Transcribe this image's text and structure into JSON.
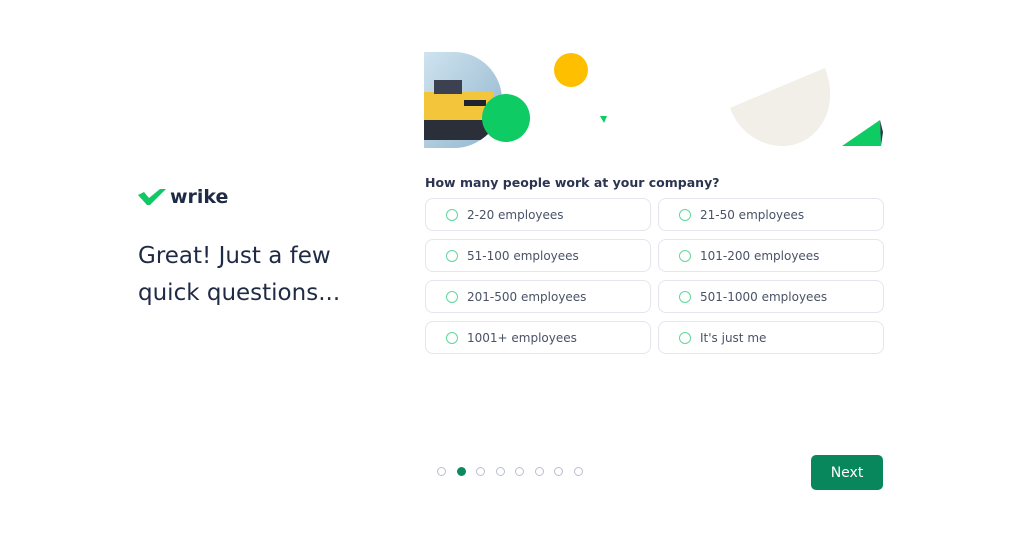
{
  "brand": {
    "name": "wrike",
    "logo_icon": "wrike-check-icon",
    "accent": "#0ecb6a"
  },
  "headline": "Great! Just a few quick questions...",
  "hero": {
    "image": "race-car-image",
    "decor": [
      "yellow-circle",
      "green-circle",
      "green-triangle",
      "beige-semicircle"
    ]
  },
  "question": "How many people work at your company?",
  "options": [
    {
      "label": "2-20 employees",
      "selected": false
    },
    {
      "label": "21-50 employees",
      "selected": false
    },
    {
      "label": "51-100 employees",
      "selected": false
    },
    {
      "label": "101-200 employees",
      "selected": false
    },
    {
      "label": "201-500 employees",
      "selected": false
    },
    {
      "label": "501-1000 employees",
      "selected": false
    },
    {
      "label": "1001+ employees",
      "selected": false
    },
    {
      "label": "It's just me",
      "selected": false
    }
  ],
  "pagination": {
    "total": 8,
    "current": 2
  },
  "next_button": {
    "label": "Next",
    "color": "#08875d"
  }
}
